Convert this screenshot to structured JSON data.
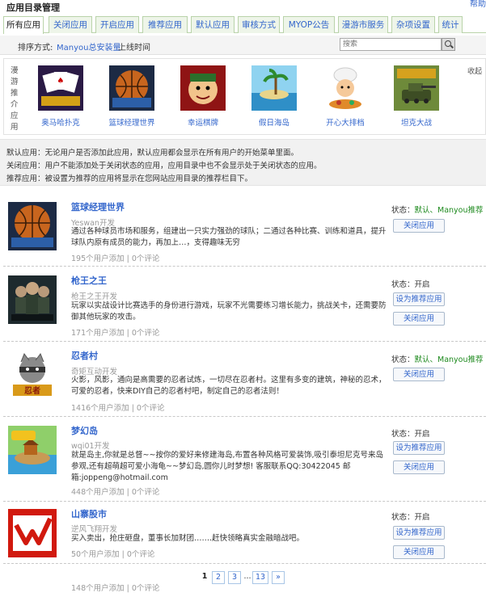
{
  "header": {
    "title": "应用目录管理",
    "corner": "帮助"
  },
  "tabs": [
    "所有应用",
    "关闭应用",
    "开启应用",
    "推荐应用",
    "默认应用",
    "审核方式",
    "MYOP公告",
    "漫游市服务",
    "杂项设置",
    "统计"
  ],
  "sort": {
    "label": "排序方式:",
    "by_installs": "Manyou总安装量",
    "by_time": "上线时间"
  },
  "search": {
    "placeholder": "搜索"
  },
  "featured": {
    "vertical_label": "漫游推介应用",
    "close_label": "收起",
    "items": [
      {
        "name": "奥马哈扑克",
        "icon": "poker-cards-icon"
      },
      {
        "name": "篮球经理世界",
        "icon": "basketball-icon"
      },
      {
        "name": "幸运棋牌",
        "icon": "luck-character-icon"
      },
      {
        "name": "假日海岛",
        "icon": "island-icon"
      },
      {
        "name": "开心大排档",
        "icon": "chef-icon"
      },
      {
        "name": "坦克大战",
        "icon": "tank-icon"
      }
    ]
  },
  "notes": [
    "默认应用：无论用户是否添加此应用，默认应用都会显示在所有用户的开始菜单里面。",
    "关闭应用：用户不能添加处于关闭状态的应用，应用目录中也不会显示处于关闭状态的应用。",
    "推荐应用：被设置为推荐的应用将显示在您网站应用目录的推荐栏目下。"
  ],
  "apps": [
    {
      "name": "篮球经理世界",
      "developer": "Yeswan开发",
      "icon": "basketball-icon",
      "desc": "通过各种球员市场和服务，组建出一只实力强劲的球队；二通过各种比赛、训练和道具，提升球队内原有成员的能力，再加上…，支得趣味无穷",
      "stats": "195个用户添加 | 0个评论",
      "status_label": "状态：",
      "status_value": "默认、Manyou推荐",
      "buttons": [
        "关闭应用"
      ]
    },
    {
      "name": "枪王之王",
      "developer": "枪王之王开发",
      "icon": "soldiers-icon",
      "desc": "玩家以实战设计比赛选手的身份进行游戏，玩家不光需要练习增长能力，挑战关卡，还需要防御其他玩家的攻击。",
      "stats": "171个用户添加 | 0个评论",
      "status_label": "状态：",
      "status_value": "开启",
      "buttons": [
        "设为推荐应用",
        "关闭应用"
      ]
    },
    {
      "name": "忍者村",
      "developer": "奇矩互动开发",
      "icon": "ninja-icon",
      "desc": "火影，风影，通向是高需要的忍者试炼，一切尽在忍者村。这里有多变的建筑，神秘的忍术，可爱的忍者，快来DIY自己的忍者村吧，制定自己的忍者法则！",
      "stats": "1416个用户添加 | 0个评论",
      "status_label": "状态：",
      "status_value": "默认、Manyou推荐",
      "buttons": [
        "关闭应用"
      ]
    },
    {
      "name": "梦幻岛",
      "developer": "wqi01开发",
      "icon": "dream-island-icon",
      "desc": "就是岛主,你就是总督~~按你的爱好来修建海岛,布置各种风格可爱装饰,吸引泰坦尼克号来岛参观,还有超萌超可爱小海龟~~梦幻岛,圆你儿时梦想! 客服联系QQ:30422045 邮箱:joppeng@hotmail.com",
      "stats": "448个用户添加 | 0个评论",
      "status_label": "状态：",
      "status_value": "开启",
      "buttons": [
        "设为推荐应用",
        "关闭应用"
      ]
    },
    {
      "name": "山寨股市",
      "developer": "逆风飞翔开发",
      "icon": "stock-chart-icon",
      "desc": "买入卖出，抢庄砸盘，董事长加财团…….赶快领略真实金融暗战吧。",
      "stats": "50个用户添加 | 0个评论",
      "status_label": "状态：",
      "status_value": "开启",
      "buttons": [
        "设为推荐应用",
        "关闭应用"
      ]
    }
  ],
  "partial_row_stats": "148个用户添加 | 0个评论",
  "pagination": {
    "current": "1",
    "pages": [
      "2",
      "3"
    ],
    "dots": "...",
    "last": "13",
    "next": "»"
  }
}
